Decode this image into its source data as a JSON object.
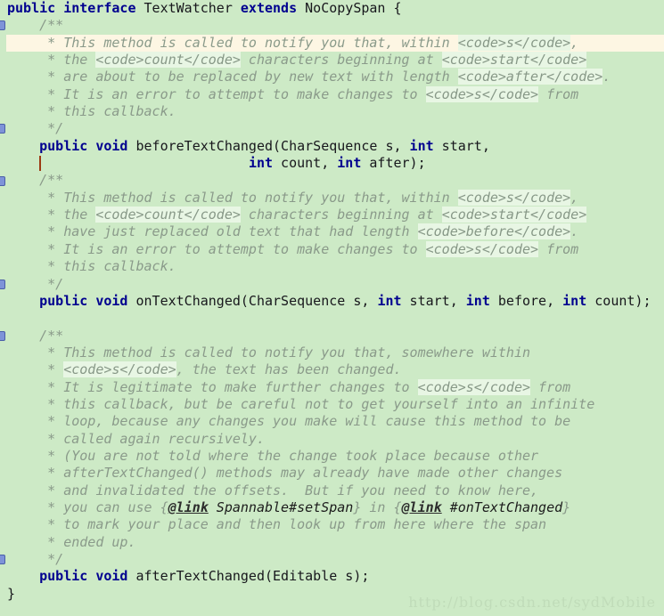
{
  "editor": {
    "background_color": "#cdeac6",
    "current_line_color": "#fdf6e3",
    "keyword_color": "#00008f",
    "comment_color": "#8a9a8a",
    "caret_color": "#9c3b14",
    "fold_marker_color": "#7e93d8",
    "language": "java",
    "type_name": "TextWatcher"
  },
  "watermark": {
    "text": "http://blog.csdn.net/sydMobile"
  },
  "code": {
    "lines": [
      {
        "n": 1,
        "current": false,
        "fold": false,
        "tokens": [
          {
            "t": "kw",
            "s": "public"
          },
          {
            "t": "id",
            "s": " "
          },
          {
            "t": "kw",
            "s": "interface"
          },
          {
            "t": "id",
            "s": " TextWatcher "
          },
          {
            "t": "kw",
            "s": "extends"
          },
          {
            "t": "id",
            "s": " NoCopySpan {"
          }
        ]
      },
      {
        "n": 2,
        "current": false,
        "fold": true,
        "tokens": [
          {
            "t": "cmt",
            "s": "    /**"
          }
        ]
      },
      {
        "n": 3,
        "current": true,
        "fold": false,
        "tokens": [
          {
            "t": "cmt",
            "s": "     * This method is called to notify you that, within "
          },
          {
            "t": "cmt-code",
            "s": "<code>s</code>"
          },
          {
            "t": "cmt",
            "s": ","
          }
        ]
      },
      {
        "n": 4,
        "current": false,
        "fold": false,
        "tokens": [
          {
            "t": "cmt",
            "s": "     * the "
          },
          {
            "t": "cmt-code",
            "s": "<code>count</code>"
          },
          {
            "t": "cmt",
            "s": " characters beginning at "
          },
          {
            "t": "cmt-code",
            "s": "<code>start</code>"
          }
        ]
      },
      {
        "n": 5,
        "current": false,
        "fold": false,
        "tokens": [
          {
            "t": "cmt",
            "s": "     * are about to be replaced by new text with length "
          },
          {
            "t": "cmt-code",
            "s": "<code>after</code>"
          },
          {
            "t": "cmt",
            "s": "."
          }
        ]
      },
      {
        "n": 6,
        "current": false,
        "fold": false,
        "tokens": [
          {
            "t": "cmt",
            "s": "     * It is an error to attempt to make changes to "
          },
          {
            "t": "cmt-code",
            "s": "<code>s</code>"
          },
          {
            "t": "cmt",
            "s": " from"
          }
        ]
      },
      {
        "n": 7,
        "current": false,
        "fold": false,
        "tokens": [
          {
            "t": "cmt",
            "s": "     * this callback."
          }
        ]
      },
      {
        "n": 8,
        "current": false,
        "fold": true,
        "tokens": [
          {
            "t": "cmt",
            "s": "     */"
          }
        ]
      },
      {
        "n": 9,
        "current": false,
        "fold": false,
        "tokens": [
          {
            "t": "id",
            "s": "    "
          },
          {
            "t": "kw",
            "s": "public"
          },
          {
            "t": "id",
            "s": " "
          },
          {
            "t": "kw",
            "s": "void"
          },
          {
            "t": "id",
            "s": " beforeTextChanged(CharSequence s, "
          },
          {
            "t": "kw",
            "s": "int"
          },
          {
            "t": "id",
            "s": " start,"
          }
        ]
      },
      {
        "n": 10,
        "current": false,
        "fold": false,
        "tokens": [
          {
            "t": "id",
            "s": "                              "
          },
          {
            "t": "kw",
            "s": "int"
          },
          {
            "t": "id",
            "s": " count, "
          },
          {
            "t": "kw",
            "s": "int"
          },
          {
            "t": "id",
            "s": " after);"
          }
        ]
      },
      {
        "n": 11,
        "current": false,
        "fold": true,
        "tokens": [
          {
            "t": "cmt",
            "s": "    /**"
          }
        ]
      },
      {
        "n": 12,
        "current": false,
        "fold": false,
        "tokens": [
          {
            "t": "cmt",
            "s": "     * This method is called to notify you that, within "
          },
          {
            "t": "cmt-code",
            "s": "<code>s</code>"
          },
          {
            "t": "cmt",
            "s": ","
          }
        ]
      },
      {
        "n": 13,
        "current": false,
        "fold": false,
        "tokens": [
          {
            "t": "cmt",
            "s": "     * the "
          },
          {
            "t": "cmt-code",
            "s": "<code>count</code>"
          },
          {
            "t": "cmt",
            "s": " characters beginning at "
          },
          {
            "t": "cmt-code",
            "s": "<code>start</code>"
          }
        ]
      },
      {
        "n": 14,
        "current": false,
        "fold": false,
        "tokens": [
          {
            "t": "cmt",
            "s": "     * have just replaced old text that had length "
          },
          {
            "t": "cmt-code",
            "s": "<code>before</code>"
          },
          {
            "t": "cmt",
            "s": "."
          }
        ]
      },
      {
        "n": 15,
        "current": false,
        "fold": false,
        "tokens": [
          {
            "t": "cmt",
            "s": "     * It is an error to attempt to make changes to "
          },
          {
            "t": "cmt-code",
            "s": "<code>s</code>"
          },
          {
            "t": "cmt",
            "s": " from"
          }
        ]
      },
      {
        "n": 16,
        "current": false,
        "fold": false,
        "tokens": [
          {
            "t": "cmt",
            "s": "     * this callback."
          }
        ]
      },
      {
        "n": 17,
        "current": false,
        "fold": true,
        "tokens": [
          {
            "t": "cmt",
            "s": "     */"
          }
        ]
      },
      {
        "n": 18,
        "current": false,
        "fold": false,
        "tokens": [
          {
            "t": "id",
            "s": "    "
          },
          {
            "t": "kw",
            "s": "public"
          },
          {
            "t": "id",
            "s": " "
          },
          {
            "t": "kw",
            "s": "void"
          },
          {
            "t": "id",
            "s": " onTextChanged(CharSequence s, "
          },
          {
            "t": "kw",
            "s": "int"
          },
          {
            "t": "id",
            "s": " start, "
          },
          {
            "t": "kw",
            "s": "int"
          },
          {
            "t": "id",
            "s": " before, "
          },
          {
            "t": "kw",
            "s": "int"
          },
          {
            "t": "id",
            "s": " count);"
          }
        ]
      },
      {
        "n": 19,
        "current": false,
        "fold": false,
        "tokens": []
      },
      {
        "n": 20,
        "current": false,
        "fold": true,
        "tokens": [
          {
            "t": "cmt",
            "s": "    /**"
          }
        ]
      },
      {
        "n": 21,
        "current": false,
        "fold": false,
        "tokens": [
          {
            "t": "cmt",
            "s": "     * This method is called to notify you that, somewhere within"
          }
        ]
      },
      {
        "n": 22,
        "current": false,
        "fold": false,
        "tokens": [
          {
            "t": "cmt",
            "s": "     * "
          },
          {
            "t": "cmt-code",
            "s": "<code>s</code>"
          },
          {
            "t": "cmt",
            "s": ", the text has been changed."
          }
        ]
      },
      {
        "n": 23,
        "current": false,
        "fold": false,
        "tokens": [
          {
            "t": "cmt",
            "s": "     * It is legitimate to make further changes to "
          },
          {
            "t": "cmt-code",
            "s": "<code>s</code>"
          },
          {
            "t": "cmt",
            "s": " from"
          }
        ]
      },
      {
        "n": 24,
        "current": false,
        "fold": false,
        "tokens": [
          {
            "t": "cmt",
            "s": "     * this callback, but be careful not to get yourself into an infinite"
          }
        ]
      },
      {
        "n": 25,
        "current": false,
        "fold": false,
        "tokens": [
          {
            "t": "cmt",
            "s": "     * loop, because any changes you make will cause this method to be"
          }
        ]
      },
      {
        "n": 26,
        "current": false,
        "fold": false,
        "tokens": [
          {
            "t": "cmt",
            "s": "     * called again recursively."
          }
        ]
      },
      {
        "n": 27,
        "current": false,
        "fold": false,
        "tokens": [
          {
            "t": "cmt",
            "s": "     * (You are not told where the change took place because other"
          }
        ]
      },
      {
        "n": 28,
        "current": false,
        "fold": false,
        "tokens": [
          {
            "t": "cmt",
            "s": "     * afterTextChanged() methods may already have made other changes"
          }
        ]
      },
      {
        "n": 29,
        "current": false,
        "fold": false,
        "tokens": [
          {
            "t": "cmt",
            "s": "     * and invalidated the offsets.  But if you need to know here,"
          }
        ]
      },
      {
        "n": 30,
        "current": false,
        "fold": false,
        "tokens": [
          {
            "t": "cmt",
            "s": "     * you can use {"
          },
          {
            "t": "jdoc-tag",
            "s": "@link"
          },
          {
            "t": "jdoc-ref",
            "s": " Spannable#setSpan"
          },
          {
            "t": "cmt",
            "s": "} in {"
          },
          {
            "t": "jdoc-tag",
            "s": "@link"
          },
          {
            "t": "jdoc-ref",
            "s": " #onTextChanged"
          },
          {
            "t": "cmt",
            "s": "}"
          }
        ]
      },
      {
        "n": 31,
        "current": false,
        "fold": false,
        "tokens": [
          {
            "t": "cmt",
            "s": "     * to mark your place and then look up from here where the span"
          }
        ]
      },
      {
        "n": 32,
        "current": false,
        "fold": false,
        "tokens": [
          {
            "t": "cmt",
            "s": "     * ended up."
          }
        ]
      },
      {
        "n": 33,
        "current": false,
        "fold": true,
        "tokens": [
          {
            "t": "cmt",
            "s": "     */"
          }
        ]
      },
      {
        "n": 34,
        "current": false,
        "fold": false,
        "tokens": [
          {
            "t": "id",
            "s": "    "
          },
          {
            "t": "kw",
            "s": "public"
          },
          {
            "t": "id",
            "s": " "
          },
          {
            "t": "kw",
            "s": "void"
          },
          {
            "t": "id",
            "s": " afterTextChanged(Editable s);"
          }
        ]
      },
      {
        "n": 35,
        "current": false,
        "fold": false,
        "tokens": [
          {
            "t": "id",
            "s": "}"
          }
        ]
      }
    ]
  },
  "caret": {
    "line": 10,
    "column": 4
  }
}
